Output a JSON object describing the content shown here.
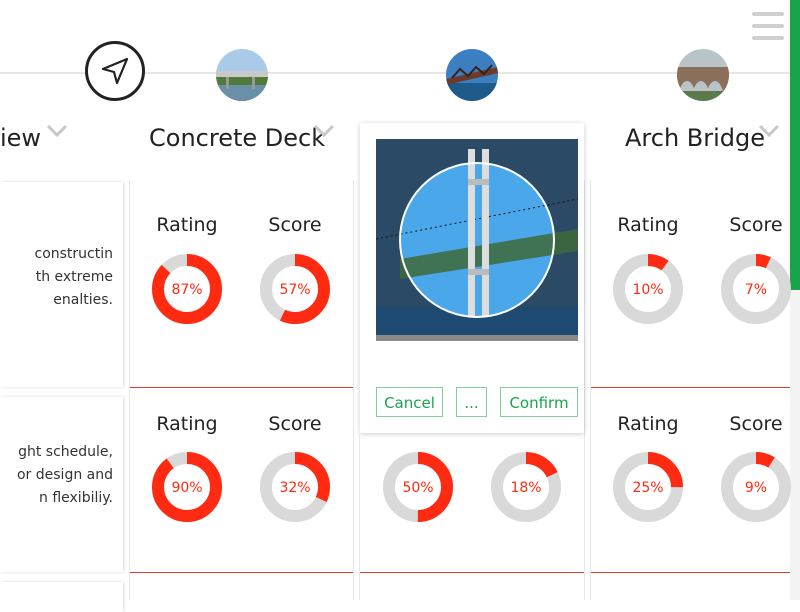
{
  "columns": [
    {
      "title": "iew"
    },
    {
      "title": "Concrete Deck"
    },
    {
      "title": "Arch Bridge"
    }
  ],
  "rows": [
    {
      "description": [
        "constructin",
        "th extreme",
        "enalties."
      ],
      "concrete": {
        "rating_label": "Rating",
        "score_label": "Score",
        "rating": "87%",
        "rating_value": 0.87,
        "score": "57%",
        "score_value": 0.57
      },
      "arch": {
        "rating_label": "Rating",
        "score_label": "Score",
        "rating": "10%",
        "rating_value": 0.1,
        "score": "7%",
        "score_value": 0.07
      }
    },
    {
      "description": [
        "ght schedule,",
        "or design and",
        "n flexibiliy."
      ],
      "concrete": {
        "rating_label": "Rating",
        "score_label": "Score",
        "rating": "90%",
        "rating_value": 0.9,
        "score": "32%",
        "score_value": 0.32
      },
      "middle": {
        "rating": "50%",
        "rating_value": 0.5,
        "score": "18%",
        "score_value": 0.18
      },
      "arch": {
        "rating_label": "Rating",
        "score_label": "Score",
        "rating": "25%",
        "rating_value": 0.25,
        "score": "9%",
        "score_value": 0.09
      }
    }
  ],
  "popup": {
    "cancel_label": "Cancel",
    "more_label": "...",
    "confirm_label": "Confirm"
  },
  "colors": {
    "accent": "#ff2a12",
    "track": "#d9d9d9",
    "green": "#17a44b"
  },
  "icons": {
    "nav": "navigation-arrow-icon",
    "menu": "hamburger-menu-icon",
    "chevron": "chevron-down-icon"
  }
}
